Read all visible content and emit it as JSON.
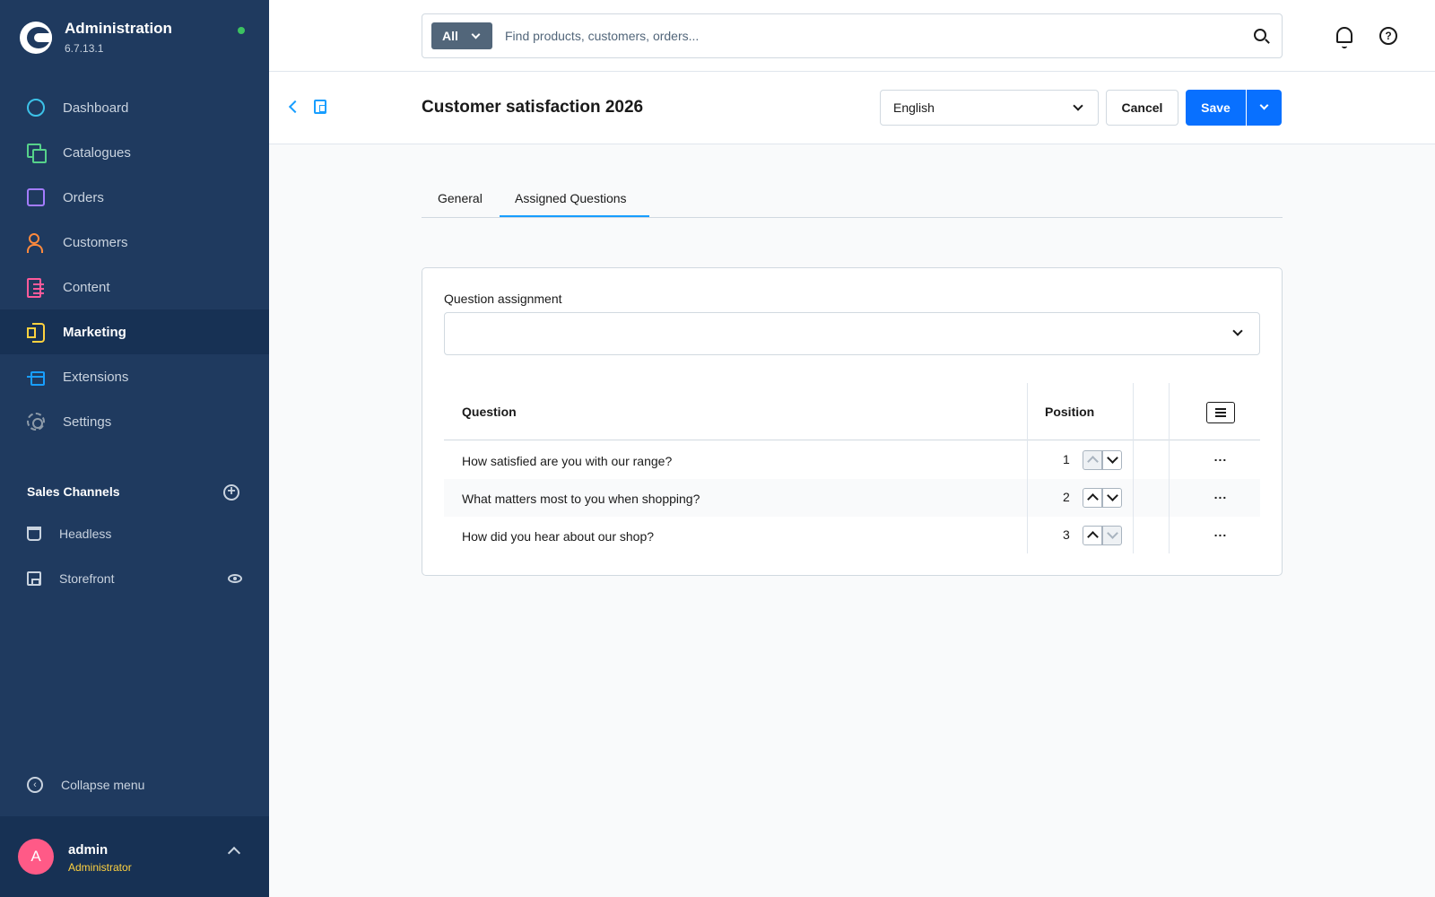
{
  "app": {
    "title": "Administration",
    "version": "6.7.13.1",
    "status_color": "#3cc261"
  },
  "sidebar": {
    "items": [
      {
        "label": "Dashboard",
        "icon": "dashboard-icon",
        "color": "#3cc2e8"
      },
      {
        "label": "Catalogues",
        "icon": "catalogue-icon",
        "color": "#56d28a"
      },
      {
        "label": "Orders",
        "icon": "orders-icon",
        "color": "#a47cff"
      },
      {
        "label": "Customers",
        "icon": "customers-icon",
        "color": "#ff8a3d"
      },
      {
        "label": "Content",
        "icon": "content-icon",
        "color": "#ff5a9a"
      },
      {
        "label": "Marketing",
        "icon": "marketing-icon",
        "color": "#ffd23f",
        "active": true
      },
      {
        "label": "Extensions",
        "icon": "extensions-icon",
        "color": "#189eff"
      },
      {
        "label": "Settings",
        "icon": "settings-icon",
        "color": "#8d9aa8"
      }
    ],
    "sales_channels_title": "Sales Channels",
    "sales_channels": [
      {
        "label": "Headless",
        "icon": "basket-icon"
      },
      {
        "label": "Storefront",
        "icon": "store-icon"
      }
    ],
    "collapse_label": "Collapse menu"
  },
  "user": {
    "initial": "A",
    "name": "admin",
    "role": "Administrator"
  },
  "search": {
    "scope": "All",
    "placeholder": "Find products, customers, orders..."
  },
  "smartbar": {
    "title": "Customer satisfaction 2026",
    "language": "English",
    "cancel_label": "Cancel",
    "save_label": "Save"
  },
  "tabs": [
    {
      "label": "General"
    },
    {
      "label": "Assigned Questions",
      "active": true
    }
  ],
  "assignment": {
    "label": "Question assignment",
    "value": ""
  },
  "grid": {
    "columns": {
      "question": "Question",
      "position": "Position"
    },
    "rows": [
      {
        "question": "How satisfied are you with our range?",
        "position": "1",
        "up_disabled": true,
        "down_disabled": false
      },
      {
        "question": "What matters most to you when shopping?",
        "position": "2",
        "up_disabled": false,
        "down_disabled": false
      },
      {
        "question": "How did you hear about our shop?",
        "position": "3",
        "up_disabled": false,
        "down_disabled": true
      }
    ],
    "row_action": "..."
  },
  "colors": {
    "sidebar": "#1f3a5f",
    "sidebar_active": "#173154",
    "primary": "#0870ff",
    "accent": "#189eff",
    "avatar": "#ff5a87"
  }
}
